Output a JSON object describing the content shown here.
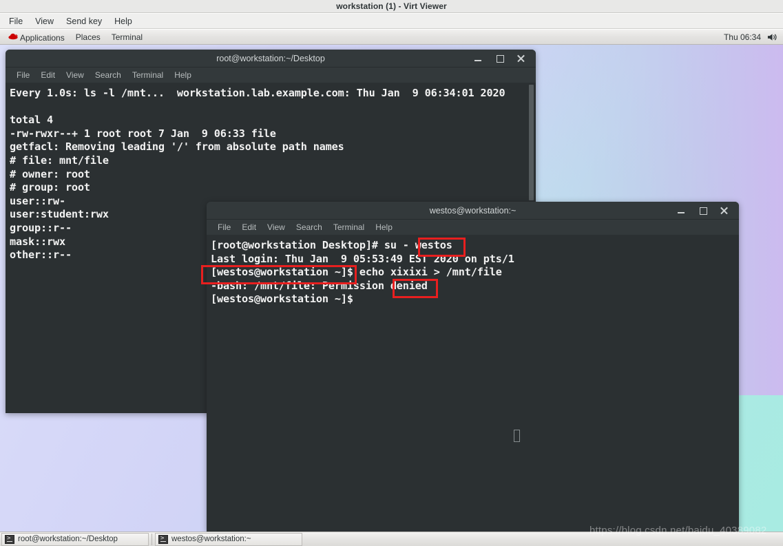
{
  "viewer": {
    "title": "workstation (1) - Virt Viewer",
    "menu": [
      "File",
      "View",
      "Send key",
      "Help"
    ]
  },
  "panel": {
    "redhat_icon": "redhat-logo-icon",
    "items": [
      "Applications",
      "Places",
      "Terminal"
    ],
    "clock": "Thu 06:34",
    "volume_icon": "volume-speaker-icon"
  },
  "windows": {
    "root_terminal": {
      "title": "root@workstation:~/Desktop",
      "menu": [
        "File",
        "Edit",
        "View",
        "Search",
        "Terminal",
        "Help"
      ],
      "controls": {
        "minimize": "minimize-icon",
        "maximize": "maximize-icon",
        "close": "close-icon"
      },
      "content": "Every 1.0s: ls -l /mnt...  workstation.lab.example.com: Thu Jan  9 06:34:01 2020\n\ntotal 4\n-rw-rwxr--+ 1 root root 7 Jan  9 06:33 file\ngetfacl: Removing leading '/' from absolute path names\n# file: mnt/file\n# owner: root\n# group: root\nuser::rw-\nuser:student:rwx\ngroup::r--\nmask::rwx\nother::r--"
    },
    "westos_terminal": {
      "title": "westos@workstation:~",
      "menu": [
        "File",
        "Edit",
        "View",
        "Search",
        "Terminal",
        "Help"
      ],
      "controls": {
        "minimize": "minimize-icon",
        "maximize": "maximize-icon",
        "close": "close-icon"
      },
      "content": "[root@workstation Desktop]# su - westos\nLast login: Thu Jan  9 05:53:49 EST 2020 on pts/1\n[westos@workstation ~]$ echo xixixi > /mnt/file\n-bash: /mnt/file: Permission denied\n[westos@workstation ~]$"
    }
  },
  "annotations": {
    "color": "#e81f1f",
    "boxes": [
      {
        "name": "highlight-westos-user",
        "label": "westos"
      },
      {
        "name": "highlight-westos-prompt",
        "label": "[westos@workstation ~]"
      },
      {
        "name": "highlight-denied",
        "label": "denied"
      }
    ]
  },
  "taskbar": {
    "buttons": [
      {
        "icon": "terminal-icon",
        "label": "root@workstation:~/Desktop"
      },
      {
        "icon": "terminal-icon",
        "label": "westos@workstation:~"
      }
    ]
  },
  "watermark": "https://blog.csdn.net/baidu_40389082"
}
